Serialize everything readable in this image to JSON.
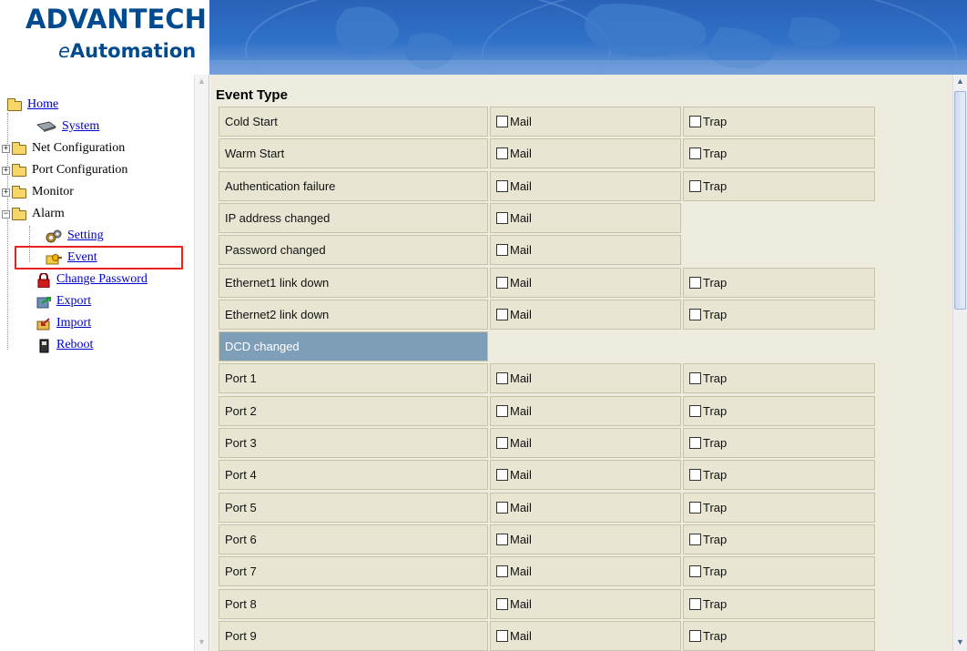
{
  "brand": {
    "name": "ADVANTECH",
    "tagline_prefix": "e",
    "tagline_rest": "Automation"
  },
  "sidebar": {
    "items": [
      {
        "label": "Home"
      },
      {
        "label": "System"
      },
      {
        "label": "Net Configuration"
      },
      {
        "label": "Port Configuration"
      },
      {
        "label": "Monitor"
      },
      {
        "label": "Alarm"
      },
      {
        "label": "Setting"
      },
      {
        "label": "Event"
      },
      {
        "label": "Change Password"
      },
      {
        "label": "Export"
      },
      {
        "label": "Import"
      },
      {
        "label": "Reboot"
      }
    ]
  },
  "main": {
    "section_title": "Event Type",
    "mail_label": "Mail",
    "trap_label": "Trap",
    "rows": [
      {
        "label": "Cold Start",
        "mail": false,
        "trap": false
      },
      {
        "label": "Warm Start",
        "mail": false,
        "trap": false
      },
      {
        "label": "Authentication failure",
        "mail": false,
        "trap": false
      },
      {
        "label": "IP address changed",
        "mail": false
      },
      {
        "label": "Password changed",
        "mail": false
      },
      {
        "label": "Ethernet1 link down",
        "mail": false,
        "trap": false
      },
      {
        "label": "Ethernet2 link down",
        "mail": false,
        "trap": false
      },
      {
        "label": "DCD changed",
        "header": true
      },
      {
        "label": "Port 1",
        "mail": false,
        "trap": false
      },
      {
        "label": "Port 2",
        "mail": false,
        "trap": false
      },
      {
        "label": "Port 3",
        "mail": false,
        "trap": false
      },
      {
        "label": "Port 4",
        "mail": false,
        "trap": false
      },
      {
        "label": "Port 5",
        "mail": false,
        "trap": false
      },
      {
        "label": "Port 6",
        "mail": false,
        "trap": false
      },
      {
        "label": "Port 7",
        "mail": false,
        "trap": false
      },
      {
        "label": "Port 8",
        "mail": false,
        "trap": false
      },
      {
        "label": "Port 9",
        "mail": false,
        "trap": false
      }
    ]
  },
  "colors": {
    "content_bg": "#eeecdf",
    "cell_bg": "#e8e6d3",
    "dcd_header_bg": "#7f9fb9",
    "highlight_border": "#e8231f",
    "brand_blue": "#004a90"
  }
}
